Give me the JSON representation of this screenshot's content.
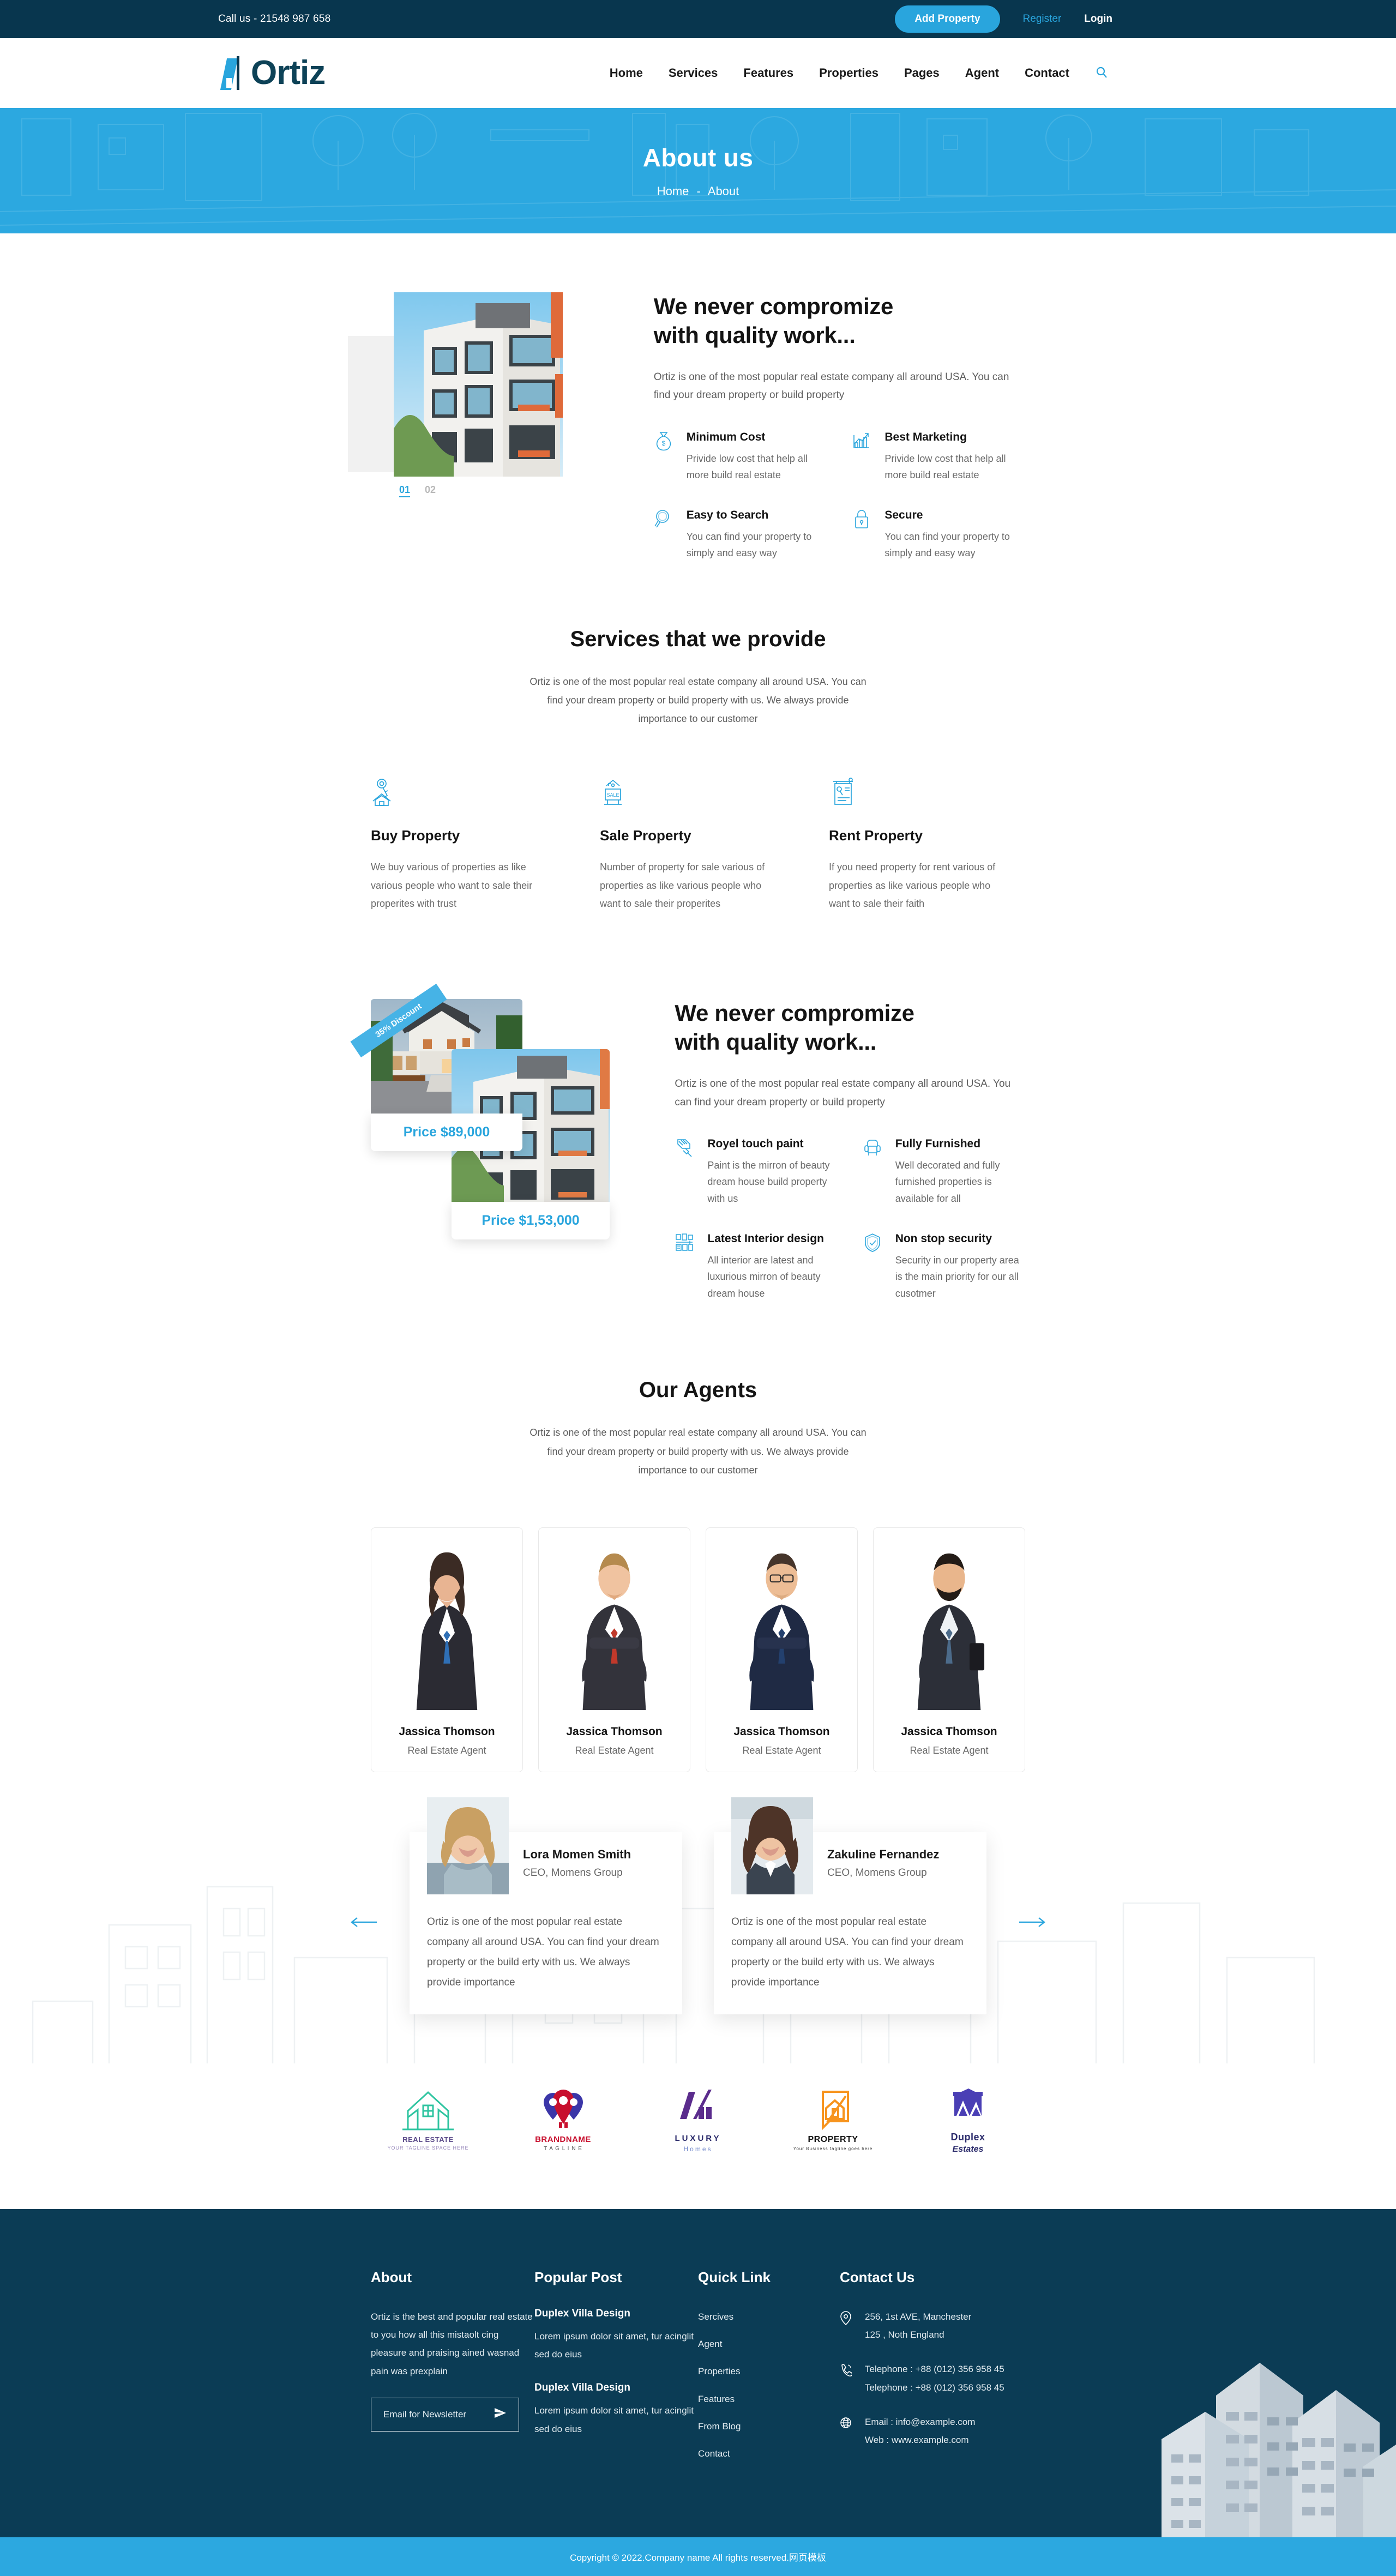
{
  "topbar": {
    "call": "Call us - 21548 987 658",
    "add_property": "Add Property",
    "register": "Register",
    "login": "Login"
  },
  "header": {
    "logo_text": "Ortiz",
    "nav": [
      {
        "label": "Home"
      },
      {
        "label": "Services"
      },
      {
        "label": "Features"
      },
      {
        "label": "Properties"
      },
      {
        "label": "Pages"
      },
      {
        "label": "Agent"
      },
      {
        "label": "Contact"
      }
    ],
    "search_icon": "search-icon"
  },
  "banner": {
    "title": "About us",
    "crumb_home": "Home",
    "crumb_sep": "-",
    "crumb_current": "About"
  },
  "section1": {
    "heading_line1": "We never compromize",
    "heading_line2": "with quality work...",
    "lead": "Ortiz is one of the most popular real estate company all around USA. You can find your dream property or build property",
    "slide_active": "01",
    "slide_inactive": "02",
    "features": [
      {
        "icon": "money-bag-icon",
        "title": "Minimum Cost",
        "text": "Privide low cost that help all more build real estate"
      },
      {
        "icon": "chart-growth-icon",
        "title": "Best Marketing",
        "text": "Privide low cost that help all more build real estate"
      },
      {
        "icon": "magnifier-icon",
        "title": "Easy to Search",
        "text": "You can find your property to simply and easy way"
      },
      {
        "icon": "lock-icon",
        "title": "Secure",
        "text": "You can find your property to simply and easy way"
      }
    ]
  },
  "services": {
    "title": "Services that we provide",
    "subtitle": "Ortiz is one of the most popular real estate company all around USA. You can find your dream property or build property with us. We always provide importance to our customer",
    "items": [
      {
        "icon": "key-house-icon",
        "title": "Buy Property",
        "text": "We buy various of properties as like various people who want to sale their properites with trust"
      },
      {
        "icon": "sale-sign-icon",
        "title": "Sale Property",
        "text": "Number of property for sale various of properties as like various people who want to sale their properites"
      },
      {
        "icon": "rent-list-icon",
        "title": "Rent Property",
        "text": "If you need property for rent various of properties as like various people who want to sale their faith"
      }
    ]
  },
  "section2": {
    "heading_line1": "We never compromize",
    "heading_line2": "with quality work...",
    "lead": "Ortiz is one of the most popular real estate company all around USA. You can find your dream property or build property",
    "ribbon": "35% Discount",
    "price1": "Price $89,000",
    "price2": "Price $1,53,000",
    "features": [
      {
        "icon": "paint-brush-icon",
        "title": "Royel touch paint",
        "text": "Paint is the mirron of beauty dream house build property with us"
      },
      {
        "icon": "armchair-icon",
        "title": "Fully Furnished",
        "text": "Well decorated and fully furnished properties is available for all"
      },
      {
        "icon": "interior-design-icon",
        "title": "Latest Interior design",
        "text": "All interior are latest and luxurious mirron of beauty dream house"
      },
      {
        "icon": "shield-check-icon",
        "title": "Non stop security",
        "text": "Security in our property area is the main priority for our all cusotmer"
      }
    ]
  },
  "agents": {
    "title": "Our Agents",
    "subtitle": "Ortiz is one of the most popular real estate company all around USA. You can find your dream property or build property with us. We always provide importance to our customer",
    "list": [
      {
        "name": "Jassica Thomson",
        "role": "Real Estate Agent"
      },
      {
        "name": "Jassica Thomson",
        "role": "Real Estate Agent"
      },
      {
        "name": "Jassica Thomson",
        "role": "Real Estate Agent"
      },
      {
        "name": "Jassica Thomson",
        "role": "Real Estate Agent"
      }
    ]
  },
  "testimonials": {
    "prev_icon": "arrow-left-icon",
    "next_icon": "arrow-right-icon",
    "items": [
      {
        "name": "Lora Momen Smith",
        "role": "CEO, Momens Group",
        "text": "Ortiz is one of the most popular real estate company all around USA. You can find your dream property or the build erty with us. We always provide importance"
      },
      {
        "name": "Zakuline Fernandez",
        "role": "CEO, Momens Group",
        "text": "Ortiz is one of the most popular real estate company all around USA. You can find your dream property or the build erty with us. We always provide importance"
      }
    ]
  },
  "brands": [
    {
      "name": "REAL ESTATE",
      "tagline": "YOUR TAGLINE SPACE HERE",
      "color": "#2ec4a0",
      "text_color": "#5b4b8a",
      "icon": "house-outline-logo"
    },
    {
      "name": "BRANDNAME",
      "tagline": "T A G L I N E",
      "color": "#3b36a8",
      "text_color": "#c8102e",
      "icon": "map-pins-logo"
    },
    {
      "name": "LUXURY",
      "tagline": "Homes",
      "color": "#5b2c8d",
      "text_color": "#2b2b6b",
      "icon": "slash-bars-logo"
    },
    {
      "name": "PROPERTY",
      "tagline": "Your Business tagline goes here",
      "color": "#f7941e",
      "text_color": "#111111",
      "icon": "house-document-logo"
    },
    {
      "name": "Duplex",
      "tagline": "Estates",
      "color": "#4a3fb5",
      "text_color": "#2b2b6b",
      "icon": "duplex-roof-logo"
    }
  ],
  "footer": {
    "about": {
      "title": "About",
      "text": "Ortiz is the best and popular real estate to you how all this mistaolt cing pleasure and praising ained wasnad pain was prexplain",
      "newsletter_placeholder": "Email for Newsletter",
      "send_icon": "send-icon"
    },
    "popular": {
      "title": "Popular Post",
      "posts": [
        {
          "title": "Duplex Villa Design",
          "text": "Lorem ipsum dolor sit amet, tur acinglit sed do eius"
        },
        {
          "title": "Duplex Villa Design",
          "text": "Lorem ipsum dolor sit amet, tur acinglit sed do eius"
        }
      ]
    },
    "quick": {
      "title": "Quick Link",
      "links": [
        {
          "label": "Sercives"
        },
        {
          "label": "Agent"
        },
        {
          "label": "Properties"
        },
        {
          "label": "Features"
        },
        {
          "label": "From Blog"
        },
        {
          "label": "Contact"
        }
      ]
    },
    "contact": {
      "title": "Contact Us",
      "address_icon": "location-pin-icon",
      "address_line1": "256, 1st AVE, Manchester",
      "address_line2": "125 , Noth England",
      "phone_icon": "phone-icon",
      "phone_line1": "Telephone : +88 (012) 356 958 45",
      "phone_line2": "Telephone : +88 (012) 356 958 45",
      "web_icon": "globe-icon",
      "email_line": "Email : info@example.com",
      "web_line": "Web : www.example.com"
    },
    "copyright": "Copyright © 2022.Company name All rights reserved.网页模板"
  },
  "colors": {
    "accent": "#29a5dd",
    "dark": "#08364e",
    "banner": "#2ca8e0",
    "footer": "#0b3c55"
  }
}
